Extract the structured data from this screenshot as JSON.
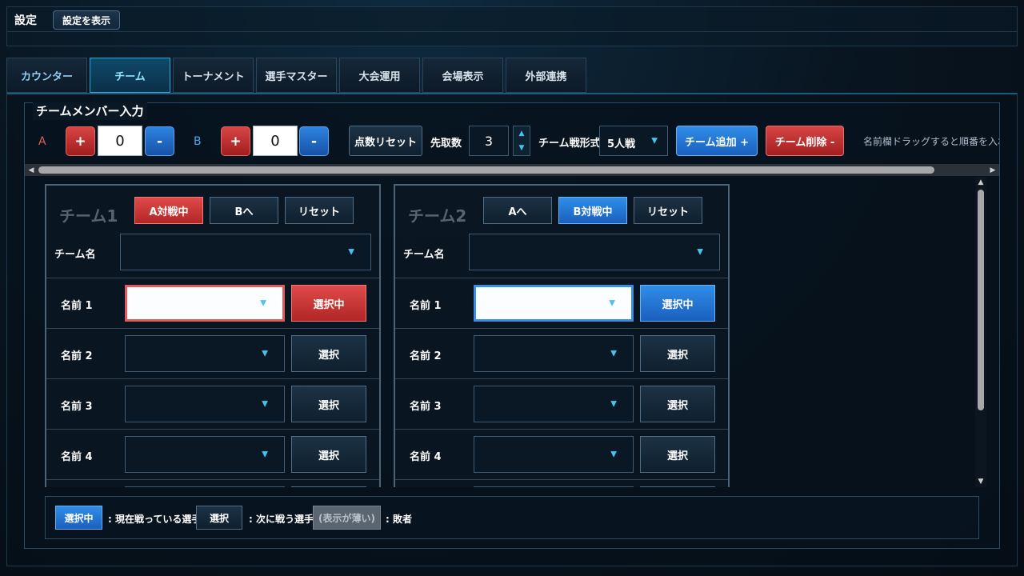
{
  "header": {
    "title": "設定",
    "show_settings_label": "設定を表示"
  },
  "tabs": [
    {
      "label": "カウンター"
    },
    {
      "label": "チーム"
    },
    {
      "label": "トーナメント"
    },
    {
      "label": "選手マスター"
    },
    {
      "label": "大会運用"
    },
    {
      "label": "会場表示"
    },
    {
      "label": "外部連携"
    }
  ],
  "active_tab": "チーム",
  "section": {
    "title": "チームメンバー入力"
  },
  "controls": {
    "team_a_letter": "A",
    "team_b_letter": "B",
    "plus_label": "+",
    "minus_label": "-",
    "score_a": "0",
    "score_b": "0",
    "reset_score_label": "点数リセット",
    "first_to_label": "先取数",
    "first_to_value": "3",
    "spin_up": "▲",
    "spin_down": "▼",
    "format_label": "チーム戦形式",
    "format_value": "5人戦",
    "add_team_label": "チーム追加 +",
    "delete_team_label": "チーム削除 -",
    "hint": "名前欄ドラッグすると順番を入れ替え"
  },
  "teams": [
    {
      "title": "チーム1",
      "buttons": [
        "A対戦中",
        "Bへ",
        "リセット"
      ],
      "team_name_label": "チーム名",
      "members": [
        {
          "label": "名前 1",
          "button": "選択中"
        },
        {
          "label": "名前 2",
          "button": "選択"
        },
        {
          "label": "名前 3",
          "button": "選択"
        },
        {
          "label": "名前 4",
          "button": "選択"
        }
      ]
    },
    {
      "title": "チーム2",
      "buttons": [
        "Aへ",
        "B対戦中",
        "リセット"
      ],
      "team_name_label": "チーム名",
      "members": [
        {
          "label": "名前 1",
          "button": "選択中"
        },
        {
          "label": "名前 2",
          "button": "選択"
        },
        {
          "label": "名前 3",
          "button": "選択"
        },
        {
          "label": "名前 4",
          "button": "選択"
        }
      ]
    }
  ],
  "legend": {
    "selected_label": "選択中",
    "selected_desc": ": 現在戦っている選手",
    "select_label": "選択",
    "select_desc": ": 次に戦う選手",
    "loser_label": "(表示が薄い)",
    "loser_desc": ": 敗者"
  },
  "colors": {
    "accent": "#2fa6d8",
    "red": "#d84444",
    "blue": "#2f8ee8",
    "bg": "#08141f"
  },
  "icons": {
    "caret": "chevron-down-icon",
    "scroll_left": "arrow-left-icon",
    "scroll_right": "arrow-right-icon",
    "scroll_up": "arrow-up-icon",
    "scroll_down": "arrow-down-icon"
  }
}
